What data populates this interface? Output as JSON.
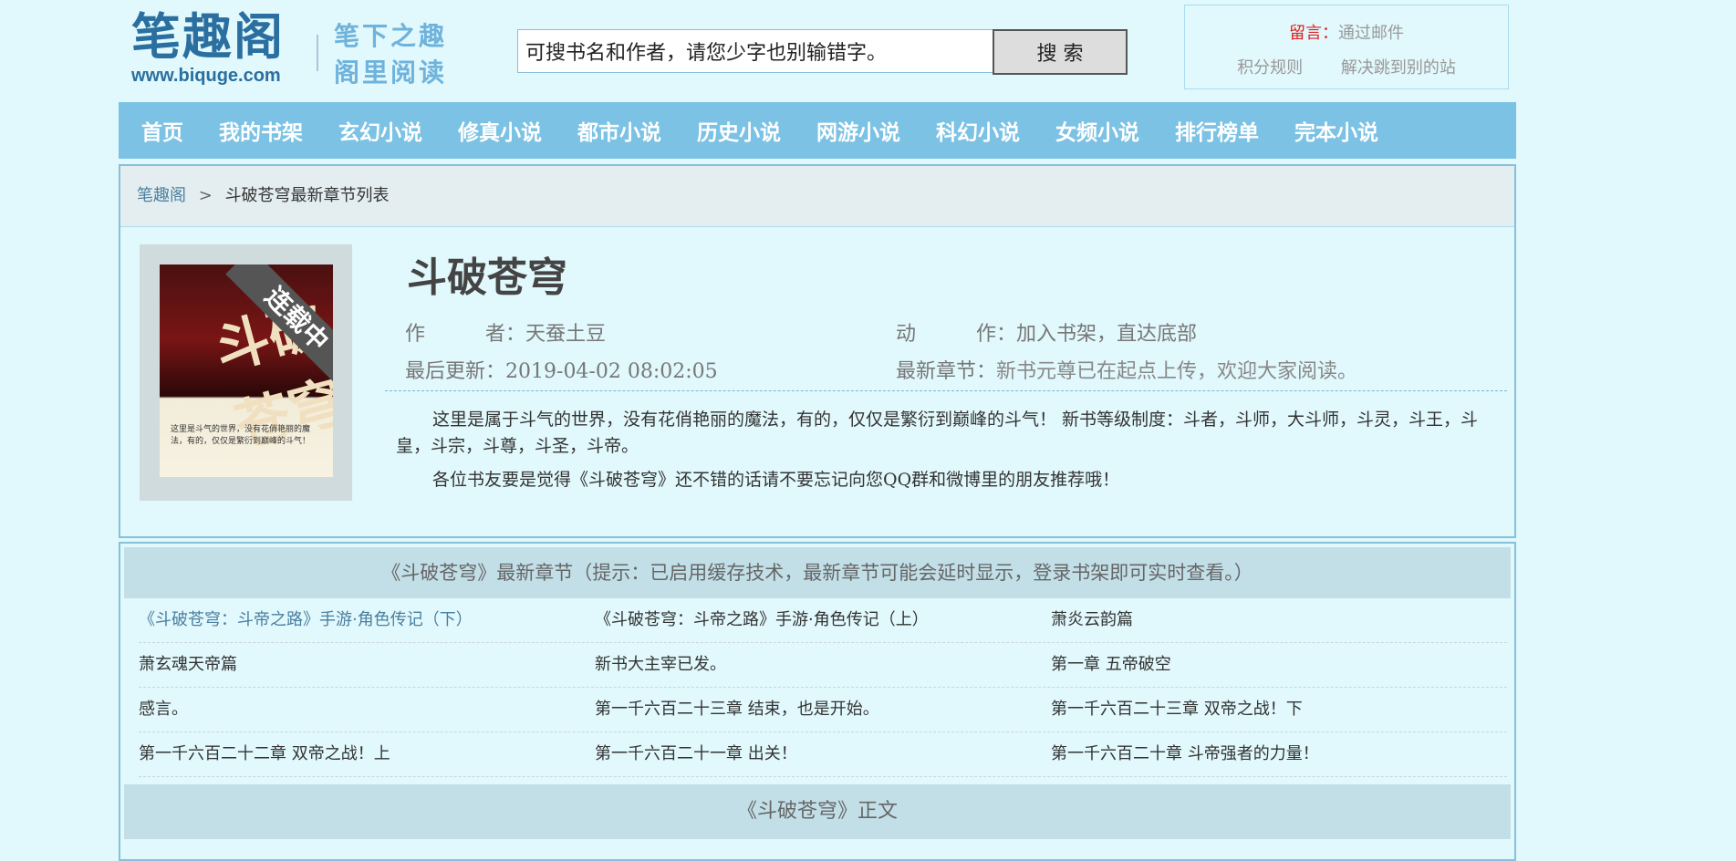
{
  "header": {
    "logo_main": "笔趣阁",
    "logo_url": "www.biquge.com",
    "logo_sub1": "笔下之趣",
    "logo_sub2": "阁里阅读",
    "search_value": "可搜书名和作者，请您少字也别输错字。",
    "search_button": "搜 索",
    "userbox": {
      "msg_label": "留言：",
      "msg_value": "通过邮件",
      "rules_link": "积分规则",
      "redirect_link": "解决跳到别的站"
    }
  },
  "nav": [
    "首页",
    "我的书架",
    "玄幻小说",
    "修真小说",
    "都市小说",
    "历史小说",
    "网游小说",
    "科幻小说",
    "女频小说",
    "排行榜单",
    "完本小说"
  ],
  "breadcrumb": {
    "home": "笔趣阁",
    "separator": ">",
    "current": "斗破苍穹最新章节列表"
  },
  "book": {
    "cover_title": "斗破苍穹",
    "cover_ribbon": "连载中",
    "cover_text": "这里是斗气的世界，没有花俏艳丽的魔法，有的，仅仅是繁衍到巅峰的斗气！",
    "title": "斗破苍穹",
    "author_label": "作　　　者：",
    "author": "天蚕土豆",
    "action_label": "动　　　作：",
    "add_shelf": "加入书架",
    "action_sep": "，",
    "to_bottom": "直达底部",
    "updated_label": "最后更新：",
    "updated": "2019-04-02 08:02:05",
    "newest_label": "最新章节：",
    "newest": "新书元尊已在起点上传，欢迎大家阅读。",
    "intro1": "这里是属于斗气的世界，没有花俏艳丽的魔法，有的，仅仅是繁衍到巅峰的斗气！ 新书等级制度：斗者，斗师，大斗师，斗灵，斗王，斗皇，斗宗，斗尊，斗圣，斗帝。",
    "intro2": "各位书友要是觉得《斗破苍穹》还不错的话请不要忘记向您QQ群和微博里的朋友推荐哦！"
  },
  "chapters": {
    "header": "《斗破苍穹》最新章节（提示：已启用缓存技术，最新章节可能会延时显示，登录书架即可实时查看。）",
    "rows": [
      [
        "《斗破苍穹：斗帝之路》手游·角色传记（下）",
        "《斗破苍穹：斗帝之路》手游·角色传记（上）",
        "萧炎云韵篇"
      ],
      [
        "萧玄魂天帝篇",
        "新书大主宰已发。",
        "第一章 五帝破空"
      ],
      [
        "感言。",
        "第一千六百二十三章 结束，也是开始。",
        "第一千六百二十三章 双帝之战！下"
      ],
      [
        "第一千六百二十二章 双帝之战！上",
        "第一千六百二十一章 出关！",
        "第一千六百二十章 斗帝强者的力量！"
      ]
    ],
    "main_header": "《斗破苍穹》正文"
  }
}
